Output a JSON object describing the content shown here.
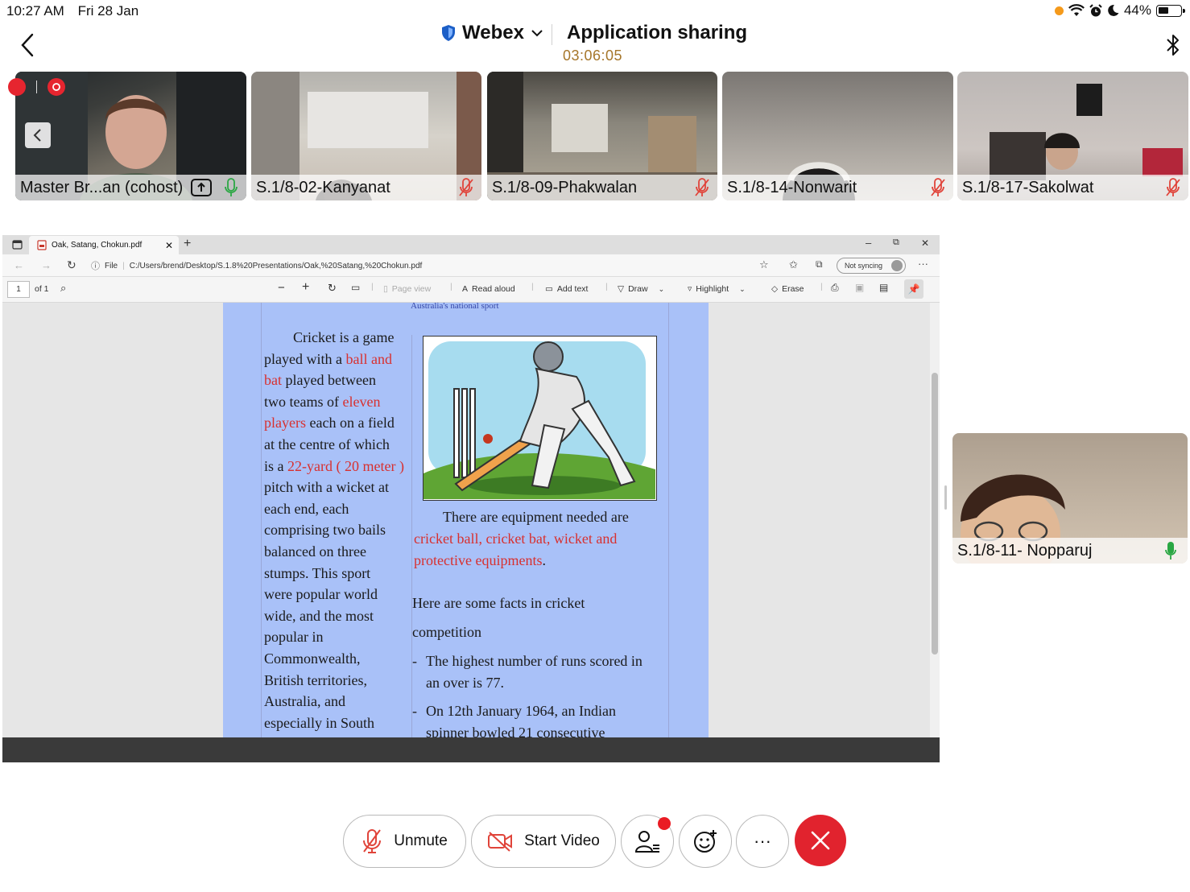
{
  "status_bar": {
    "time": "10:27 AM",
    "date": "Fri 28 Jan",
    "battery": "44%"
  },
  "header": {
    "brand": "Webex",
    "title": "Application sharing",
    "timer": "03:06:05"
  },
  "participants": [
    {
      "name": "Master Br...an (cohost)",
      "muted": false
    },
    {
      "name": "S.1/8-02-Kanyanat",
      "muted": true
    },
    {
      "name": "S.1/8-09-Phakwalan",
      "muted": true
    },
    {
      "name": "S.1/8-14-Nonwarit",
      "muted": true
    },
    {
      "name": "S.1/8-17-Sakolwat",
      "muted": true
    }
  ],
  "self_view": {
    "name": "S.1/8-11- Nopparuj"
  },
  "browser": {
    "tab_title": "Oak, Satang, Chokun.pdf",
    "url_label": "File",
    "url": "C:/Users/brend/Desktop/S.1.8%20Presentations/Oak,%20Satang,%20Chokun.pdf",
    "sync_label": "Not syncing",
    "page_input": "1",
    "page_total": "of 1",
    "toolbar": {
      "page_view": "Page view",
      "read_aloud": "Read aloud",
      "add_text": "Add text",
      "draw": "Draw",
      "highlight": "Highlight",
      "erase": "Erase"
    }
  },
  "document": {
    "caption": "Australia's national sport",
    "left_lines": [
      [
        {
          "t": "Cricket is a game",
          "r": false,
          "i": true
        }
      ],
      [
        {
          "t": "played with a ",
          "r": false
        },
        {
          "t": "ball and",
          "r": true
        }
      ],
      [
        {
          "t": "bat",
          "r": true
        },
        {
          "t": " played between",
          "r": false
        }
      ],
      [
        {
          "t": "two teams of ",
          "r": false
        },
        {
          "t": "eleven",
          "r": true
        }
      ],
      [
        {
          "t": "players",
          "r": true
        },
        {
          "t": " each on a field",
          "r": false
        }
      ],
      [
        {
          "t": "at the centre of which",
          "r": false
        }
      ],
      [
        {
          "t": "is a ",
          "r": false
        },
        {
          "t": "22-yard ( 20 meter )",
          "r": true
        }
      ],
      [
        {
          "t": "pitch with a wicket at",
          "r": false
        }
      ],
      [
        {
          "t": "each end, each",
          "r": false
        }
      ],
      [
        {
          "t": "comprising two bails",
          "r": false
        }
      ],
      [
        {
          "t": "balanced on three",
          "r": false
        }
      ],
      [
        {
          "t": "stumps. This sport",
          "r": false
        }
      ],
      [
        {
          "t": "were popular world",
          "r": false
        }
      ],
      [
        {
          "t": "wide, and the most",
          "r": false
        }
      ],
      [
        {
          "t": "popular in",
          "r": false
        }
      ],
      [
        {
          "t": "Commonwealth,",
          "r": false
        }
      ],
      [
        {
          "t": "British territories,",
          "r": false
        }
      ],
      [
        {
          "t": "Australia, and",
          "r": false
        }
      ],
      [
        {
          "t": "especially in South",
          "r": false
        }
      ]
    ],
    "equipment_intro": "There are equipment needed are",
    "equipment_line1": "cricket ball, cricket bat, wicket and",
    "equipment_line2": "protective equipments",
    "period": ".",
    "facts_line1": "Here are some facts in cricket",
    "facts_line2": "competition",
    "bullet": "-",
    "fact1_line1": "The highest number of runs scored in",
    "fact1_line2": "an over is 77.",
    "fact2_line1": "On 12th January 1964, an Indian",
    "fact2_line2": "spinner bowled 21 consecutive"
  },
  "controls": {
    "unmute": "Unmute",
    "start_video": "Start Video",
    "more": "···"
  },
  "colors": {
    "accent_red": "#e1232e",
    "timer": "#a6762a",
    "doc_red": "#d8302f",
    "page_blue": "#a9c1f8"
  }
}
